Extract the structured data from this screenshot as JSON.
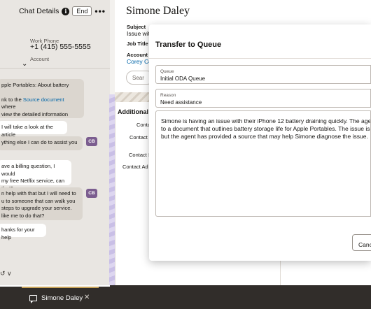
{
  "chat": {
    "header_title": "Chat Details",
    "info_glyph": "i",
    "end_button": "End",
    "more_glyph": "•••",
    "work_phone_label": "Work Phone",
    "work_phone_value": "+1 (415) 555-5555",
    "account_label": "Account",
    "messages": [
      {
        "sender": "agent",
        "lines": [
          "pple Portables: About battery"
        ]
      },
      {
        "sender": "agent",
        "lines": [
          "nk to the ",
          "Source document",
          " where",
          "view the detailed information"
        ]
      },
      {
        "sender": "customer",
        "lines": [
          "I will take a look at the article"
        ]
      },
      {
        "sender": "agent",
        "lines": [
          "ything else I can do to assist you"
        ]
      },
      {
        "sender": "customer",
        "lines": [
          "ave a billing question, I would",
          " my free Netflix service, can",
          "that?"
        ]
      },
      {
        "sender": "agent",
        "lines": [
          "n help with that but I will need to",
          "u to someone that can walk you",
          " steps to upgrade your service.",
          " like me to do that?"
        ]
      },
      {
        "sender": "customer",
        "lines": [
          "hanks for your help"
        ]
      }
    ],
    "initials": "CB",
    "input_glyphs": "↺ ∨"
  },
  "record": {
    "name": "Simone Daley",
    "subject_label": "Subject",
    "subject_value": "Issue wit",
    "job_title_label": "Job Title",
    "account_label": "Account",
    "account_value": "Corey Co",
    "search_placeholder": "Sear"
  },
  "additional": {
    "title": "Additional C",
    "labels": [
      "Conta",
      "Contact T",
      "Contact S",
      "Contact Ad"
    ]
  },
  "modal": {
    "title": "Transfer to Queue",
    "queue_label": "Queue",
    "queue_value": "Initial ODA Queue",
    "reason_label": "Reason",
    "reason_value": "Need assistance",
    "notes_lines": [
      "Simone is having an issue with their iPhone 12 battery draining quickly. The agen",
      "to a document that outlines battery storage life for Apple Portables. The issue is n",
      "but the agent has provided a source that may help Simone diagnose the issue."
    ],
    "cancel_button": "Cancel"
  },
  "bottom": {
    "tab_name": "Simone Daley",
    "close_glyph": "✕"
  },
  "colors": {
    "bottom_bar": "#312d2a",
    "link": "#0065a8",
    "initials_badge": "#7b5d8f"
  }
}
